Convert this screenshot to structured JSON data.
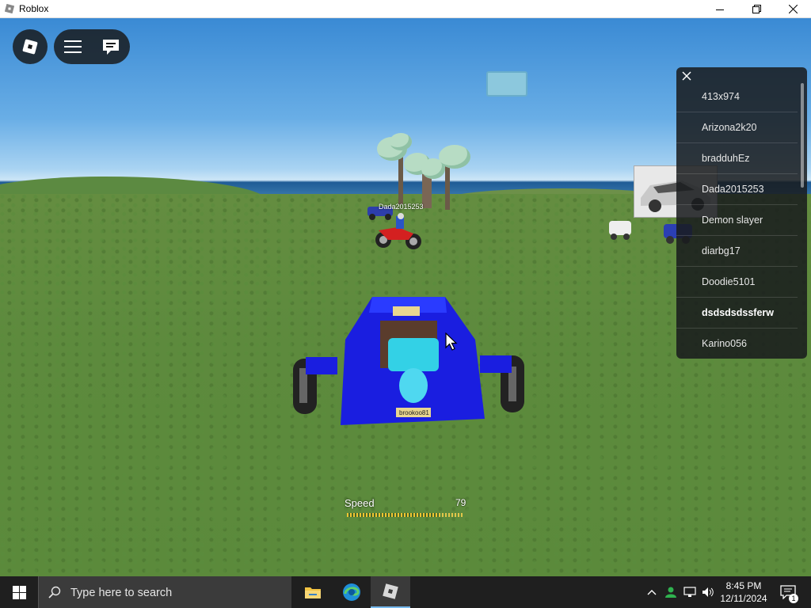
{
  "window": {
    "title": "Roblox"
  },
  "game": {
    "overhead_name": "Dada2015253",
    "plate": "brookoo81"
  },
  "player_list": {
    "players": [
      {
        "name": "413x974",
        "bold": false
      },
      {
        "name": "Arizona2k20",
        "bold": false
      },
      {
        "name": "bradduhEz",
        "bold": false
      },
      {
        "name": "Dada2015253",
        "bold": false
      },
      {
        "name": "Demon slayer",
        "bold": false
      },
      {
        "name": "diarbg17",
        "bold": false
      },
      {
        "name": "Doodie5101",
        "bold": false
      },
      {
        "name": "dsdsdsdssferw",
        "bold": true
      },
      {
        "name": "Karino056",
        "bold": false
      }
    ]
  },
  "speed": {
    "label": "Speed",
    "value": "79",
    "fill_fraction": 0.79
  },
  "taskbar": {
    "search_placeholder": "Type here to search",
    "time": "8:45 PM",
    "date": "12/11/2024",
    "notification_count": "1"
  },
  "colors": {
    "accent": "#76b9ed",
    "car_blue": "#1a1ee0",
    "hud_bg": "#191b1d"
  }
}
